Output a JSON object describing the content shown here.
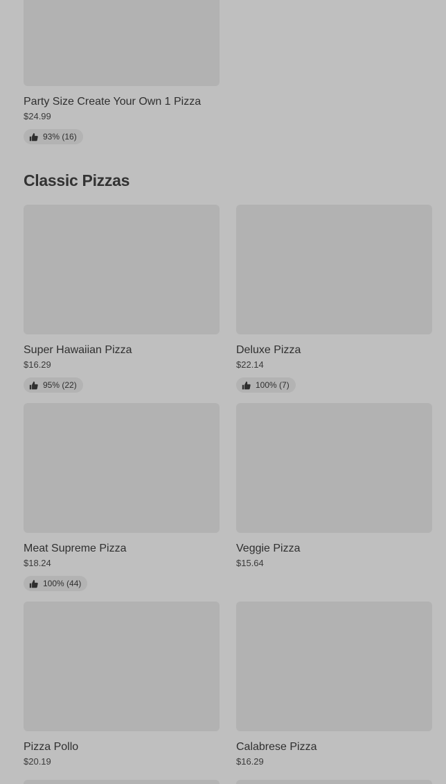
{
  "top_item": {
    "title": "Party Size Create Your Own 1 Pizza",
    "price": "$24.99",
    "rating": "93% (16)"
  },
  "section": {
    "title": "Classic Pizzas"
  },
  "items": [
    {
      "title": "Super Hawaiian Pizza",
      "price": "$16.29",
      "rating": "95% (22)"
    },
    {
      "title": "Deluxe Pizza",
      "price": "$22.14",
      "rating": "100% (7)"
    },
    {
      "title": "Meat Supreme Pizza",
      "price": "$18.24",
      "rating": "100% (44)"
    },
    {
      "title": "Veggie Pizza",
      "price": "$15.64",
      "rating": ""
    },
    {
      "title": "Pizza Pollo",
      "price": "$20.19",
      "rating": ""
    },
    {
      "title": "Calabrese Pizza",
      "price": "$16.29",
      "rating": ""
    }
  ],
  "colors": {
    "background": "#bfbfbf",
    "card_image": "#b2b2b2",
    "badge": "#b3b3b3",
    "text": "#2f2f2f"
  },
  "icons": {
    "rating": "thumbs-up-icon"
  }
}
